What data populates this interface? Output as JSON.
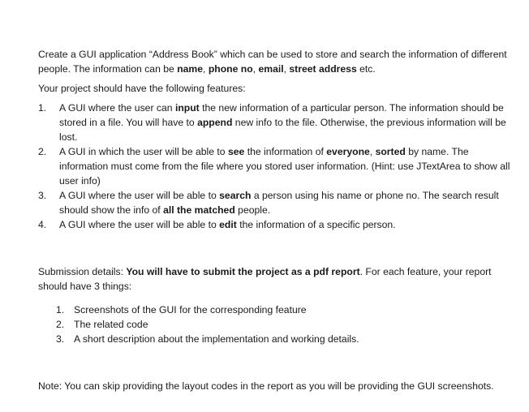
{
  "intro": {
    "t1": "Create a GUI application “Address Book” which can be used to store and search the information of different people. The information can be ",
    "b1": "name",
    "t2": ", ",
    "b2": "phone no",
    "t3": ", ",
    "b3": "email",
    "t4": ", ",
    "b4": "street address",
    "t5": " etc."
  },
  "features_lead": "Your project should have the following features:",
  "features": [
    {
      "num": "1.",
      "t1": "A GUI where the user can ",
      "b1": "input",
      "t2": " the new information of a particular person. The information should be stored in a file. You will have to ",
      "b2": "append",
      "t3": " new info to the file. Otherwise, the previous information will be lost."
    },
    {
      "num": "2.",
      "t1": "A GUI in which the user will be able to ",
      "b1": "see",
      "t2": " the information of ",
      "b2": "everyone",
      "t3": ", ",
      "b3": "sorted",
      "t4": " by name. The information must come from the file where you stored user information. (Hint: use JTextArea to show all user info)"
    },
    {
      "num": "3.",
      "t1": "A GUI where the user will be able to ",
      "b1": "search",
      "t2": " a person using his name or phone no. The search result should show the info of ",
      "b2": "all the matched",
      "t3": " people."
    },
    {
      "num": "4.",
      "t1": "A GUI where the user will be able to ",
      "b1": "edit",
      "t2": " the information of a specific person."
    }
  ],
  "submission": {
    "t1": "Submission details: ",
    "b1": "You will have to submit the project as a pdf report",
    "t2": ". For each feature, your report should have 3 things:"
  },
  "submission_items": [
    {
      "num": "1.",
      "text": "Screenshots of the GUI for the corresponding feature"
    },
    {
      "num": "2.",
      "text": "The related code"
    },
    {
      "num": "3.",
      "text": "A short description about the implementation and working details."
    }
  ],
  "note": "Note: You can skip providing the layout codes in the report as you will be providing the GUI screenshots."
}
